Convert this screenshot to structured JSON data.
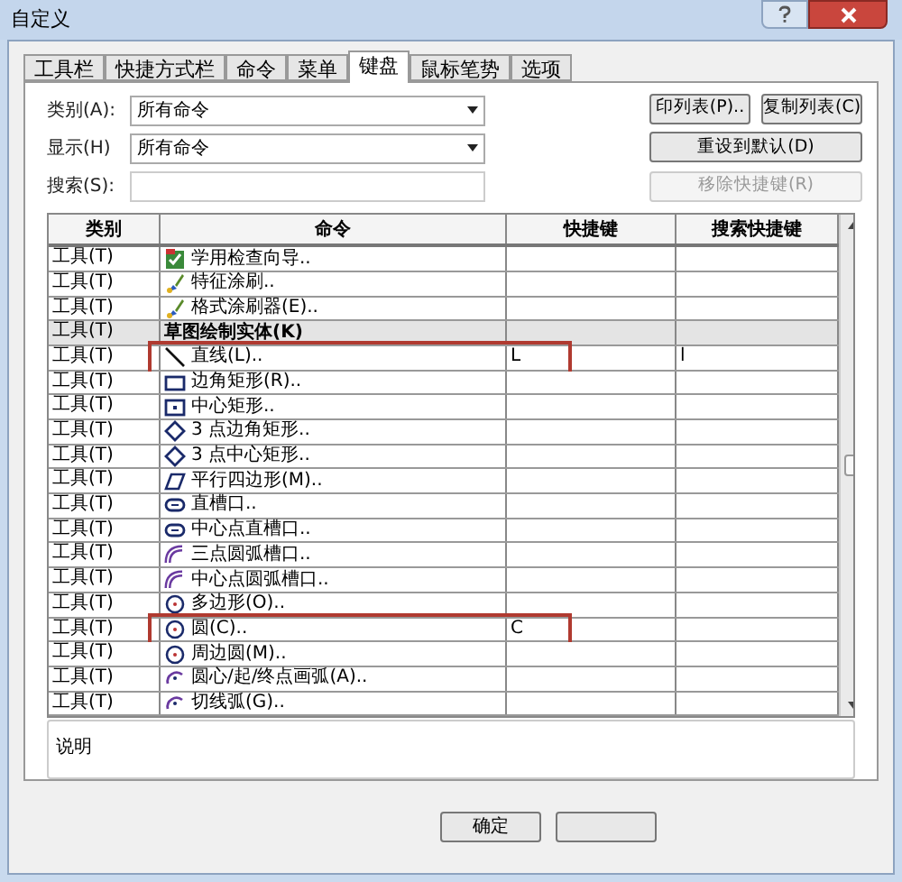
{
  "window": {
    "title": "自定义"
  },
  "tabs": [
    {
      "label": "工具栏",
      "selected": false
    },
    {
      "label": "快捷方式栏",
      "selected": false
    },
    {
      "label": "命令",
      "selected": false
    },
    {
      "label": "菜单",
      "selected": false
    },
    {
      "label": "键盘",
      "selected": true
    },
    {
      "label": "鼠标笔势",
      "selected": false
    },
    {
      "label": "选项",
      "selected": false
    }
  ],
  "filters": [
    {
      "label": "类别(A):",
      "kind": "dropdown",
      "value": "所有命令"
    },
    {
      "label": "显示(H)",
      "kind": "dropdown",
      "value": "所有命令"
    },
    {
      "label": "搜索(S):",
      "kind": "text"
    }
  ],
  "buttons": [
    {
      "label": "印列表(P)..",
      "disabled": false
    },
    {
      "label": "复制列表(C)",
      "disabled": false
    },
    {
      "label": "重设到默认(D)",
      "disabled": false
    },
    {
      "label": "移除快捷键(R)",
      "disabled": true
    }
  ],
  "table": {
    "columns": [
      "类别",
      "命令",
      "快捷键",
      "搜索快捷键"
    ],
    "rows": [
      {
        "category": "工具(T)",
        "command": "学用检查向导..",
        "kind": "check",
        "highlighted": false
      },
      {
        "category": "工具(T)",
        "command": "特征涂刷..",
        "kind": "brush",
        "highlighted": false
      },
      {
        "category": "工具(T)",
        "command": "格式涂刷器(E)..",
        "kind": "brush",
        "highlighted": false
      },
      {
        "category": "工具(T)",
        "command": "草图绘制实体(K)",
        "kind": "heading",
        "highlighted": false
      },
      {
        "category": "工具(T)",
        "command": "直线(L)..",
        "kind": "line",
        "shortcut": "L",
        "search": "l",
        "highlighted": true
      },
      {
        "category": "工具(T)",
        "command": "边角矩形(R)..",
        "kind": "rect",
        "highlighted": false
      },
      {
        "category": "工具(T)",
        "command": "中心矩形..",
        "kind": "centerrect",
        "highlighted": false
      },
      {
        "category": "工具(T)",
        "command": "3 点边角矩形..",
        "kind": "diamond",
        "highlighted": false
      },
      {
        "category": "工具(T)",
        "command": "3 点中心矩形..",
        "kind": "diamond",
        "highlighted": false
      },
      {
        "category": "工具(T)",
        "command": "平行四边形(M)..",
        "kind": "parallelogram",
        "highlighted": false
      },
      {
        "category": "工具(T)",
        "command": "直槽口..",
        "kind": "slot",
        "highlighted": false
      },
      {
        "category": "工具(T)",
        "command": "中心点直槽口..",
        "kind": "slot",
        "highlighted": false
      },
      {
        "category": "工具(T)",
        "command": "三点圆弧槽口..",
        "kind": "arcslot",
        "highlighted": false
      },
      {
        "category": "工具(T)",
        "command": "中心点圆弧槽口..",
        "kind": "arcslot",
        "highlighted": false
      },
      {
        "category": "工具(T)",
        "command": "多边形(O)..",
        "kind": "circle",
        "highlighted": false
      },
      {
        "category": "工具(T)",
        "command": "圆(C)..",
        "kind": "circle",
        "shortcut": "C",
        "highlighted": true
      },
      {
        "category": "工具(T)",
        "command": "周边圆(M)..",
        "kind": "circle",
        "highlighted": false
      },
      {
        "category": "工具(T)",
        "command": "圆心/起/终点画弧(A)..",
        "kind": "arc",
        "highlighted": false
      },
      {
        "category": "工具(T)",
        "command": "切线弧(G)..",
        "kind": "arc",
        "highlighted": false
      }
    ]
  },
  "description": {
    "label": "说明"
  },
  "footer_buttons": [
    {
      "label": "确定"
    }
  ]
}
